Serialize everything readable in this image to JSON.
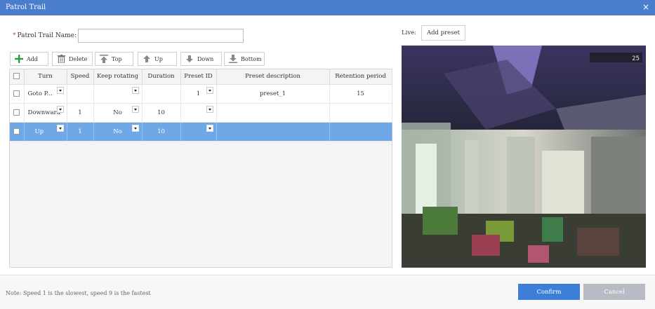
{
  "window": {
    "title": "Patrol Trail",
    "close_glyph": "×"
  },
  "form": {
    "required_mark": "*",
    "name_label": "Patrol Trail Name:",
    "name_value": "",
    "name_placeholder": ""
  },
  "toolbar": {
    "add": "Add",
    "delete": "Delete",
    "top": "Top",
    "up": "Up",
    "down": "Down",
    "bottom": "Bottom",
    "icons": [
      "plus-icon",
      "trash-icon",
      "move-top-icon",
      "arrow-up-icon",
      "arrow-down-icon",
      "move-bottom-icon"
    ],
    "add_icon_color": "#2e9e3a"
  },
  "table": {
    "columns": [
      "Turn",
      "Speed",
      "Keep rotating",
      "Duration",
      "Preset ID",
      "Preset description",
      "Retention period"
    ],
    "rows": [
      {
        "turn": "Goto P...",
        "speed": "",
        "keep_rotating": "",
        "duration": "",
        "preset_id": "1",
        "preset_description": "preset_1",
        "retention_period": "15",
        "selected": false
      },
      {
        "turn": "Downward",
        "speed": "1",
        "keep_rotating": "No",
        "duration": "10",
        "preset_id": "",
        "preset_description": "",
        "retention_period": "",
        "selected": false
      },
      {
        "turn": "Up",
        "speed": "1",
        "keep_rotating": "No",
        "duration": "10",
        "preset_id": "",
        "preset_description": "",
        "retention_period": "",
        "selected": true
      }
    ]
  },
  "live": {
    "label": "Live:",
    "add_preset": "Add preset",
    "overlay_time": "25"
  },
  "footer": {
    "note": "Note: Speed 1 is the slowest, speed 9 is the fastest",
    "confirm": "Confirm",
    "cancel": "Cancel"
  },
  "colors": {
    "titlebar": "#4a7ecd",
    "selected_row": "#6fa8e6",
    "confirm": "#3d7fd8",
    "cancel": "#b7bcc4",
    "required": "#e03a3a"
  }
}
